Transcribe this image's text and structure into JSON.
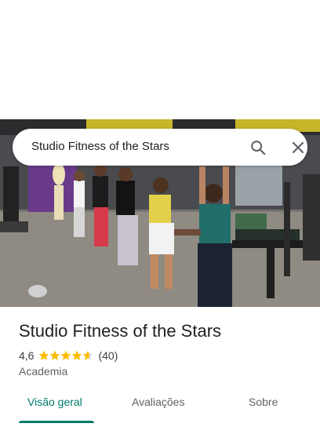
{
  "search": {
    "query": "Studio Fitness of the Stars",
    "search_icon": "search-icon",
    "close_icon": "close-icon"
  },
  "place": {
    "title": "Studio Fitness of the Stars",
    "rating_value": "4,6",
    "rating": 4.6,
    "rating_max": 5,
    "review_count": "(40)",
    "category": "Academia"
  },
  "tabs": [
    {
      "label": "Visão geral",
      "active": true
    },
    {
      "label": "Avaliações",
      "active": false
    },
    {
      "label": "Sobre",
      "active": false
    }
  ],
  "colors": {
    "accent": "#00796b",
    "star": "#fbbc04",
    "text_primary": "#202124",
    "text_secondary": "#5f6368"
  }
}
